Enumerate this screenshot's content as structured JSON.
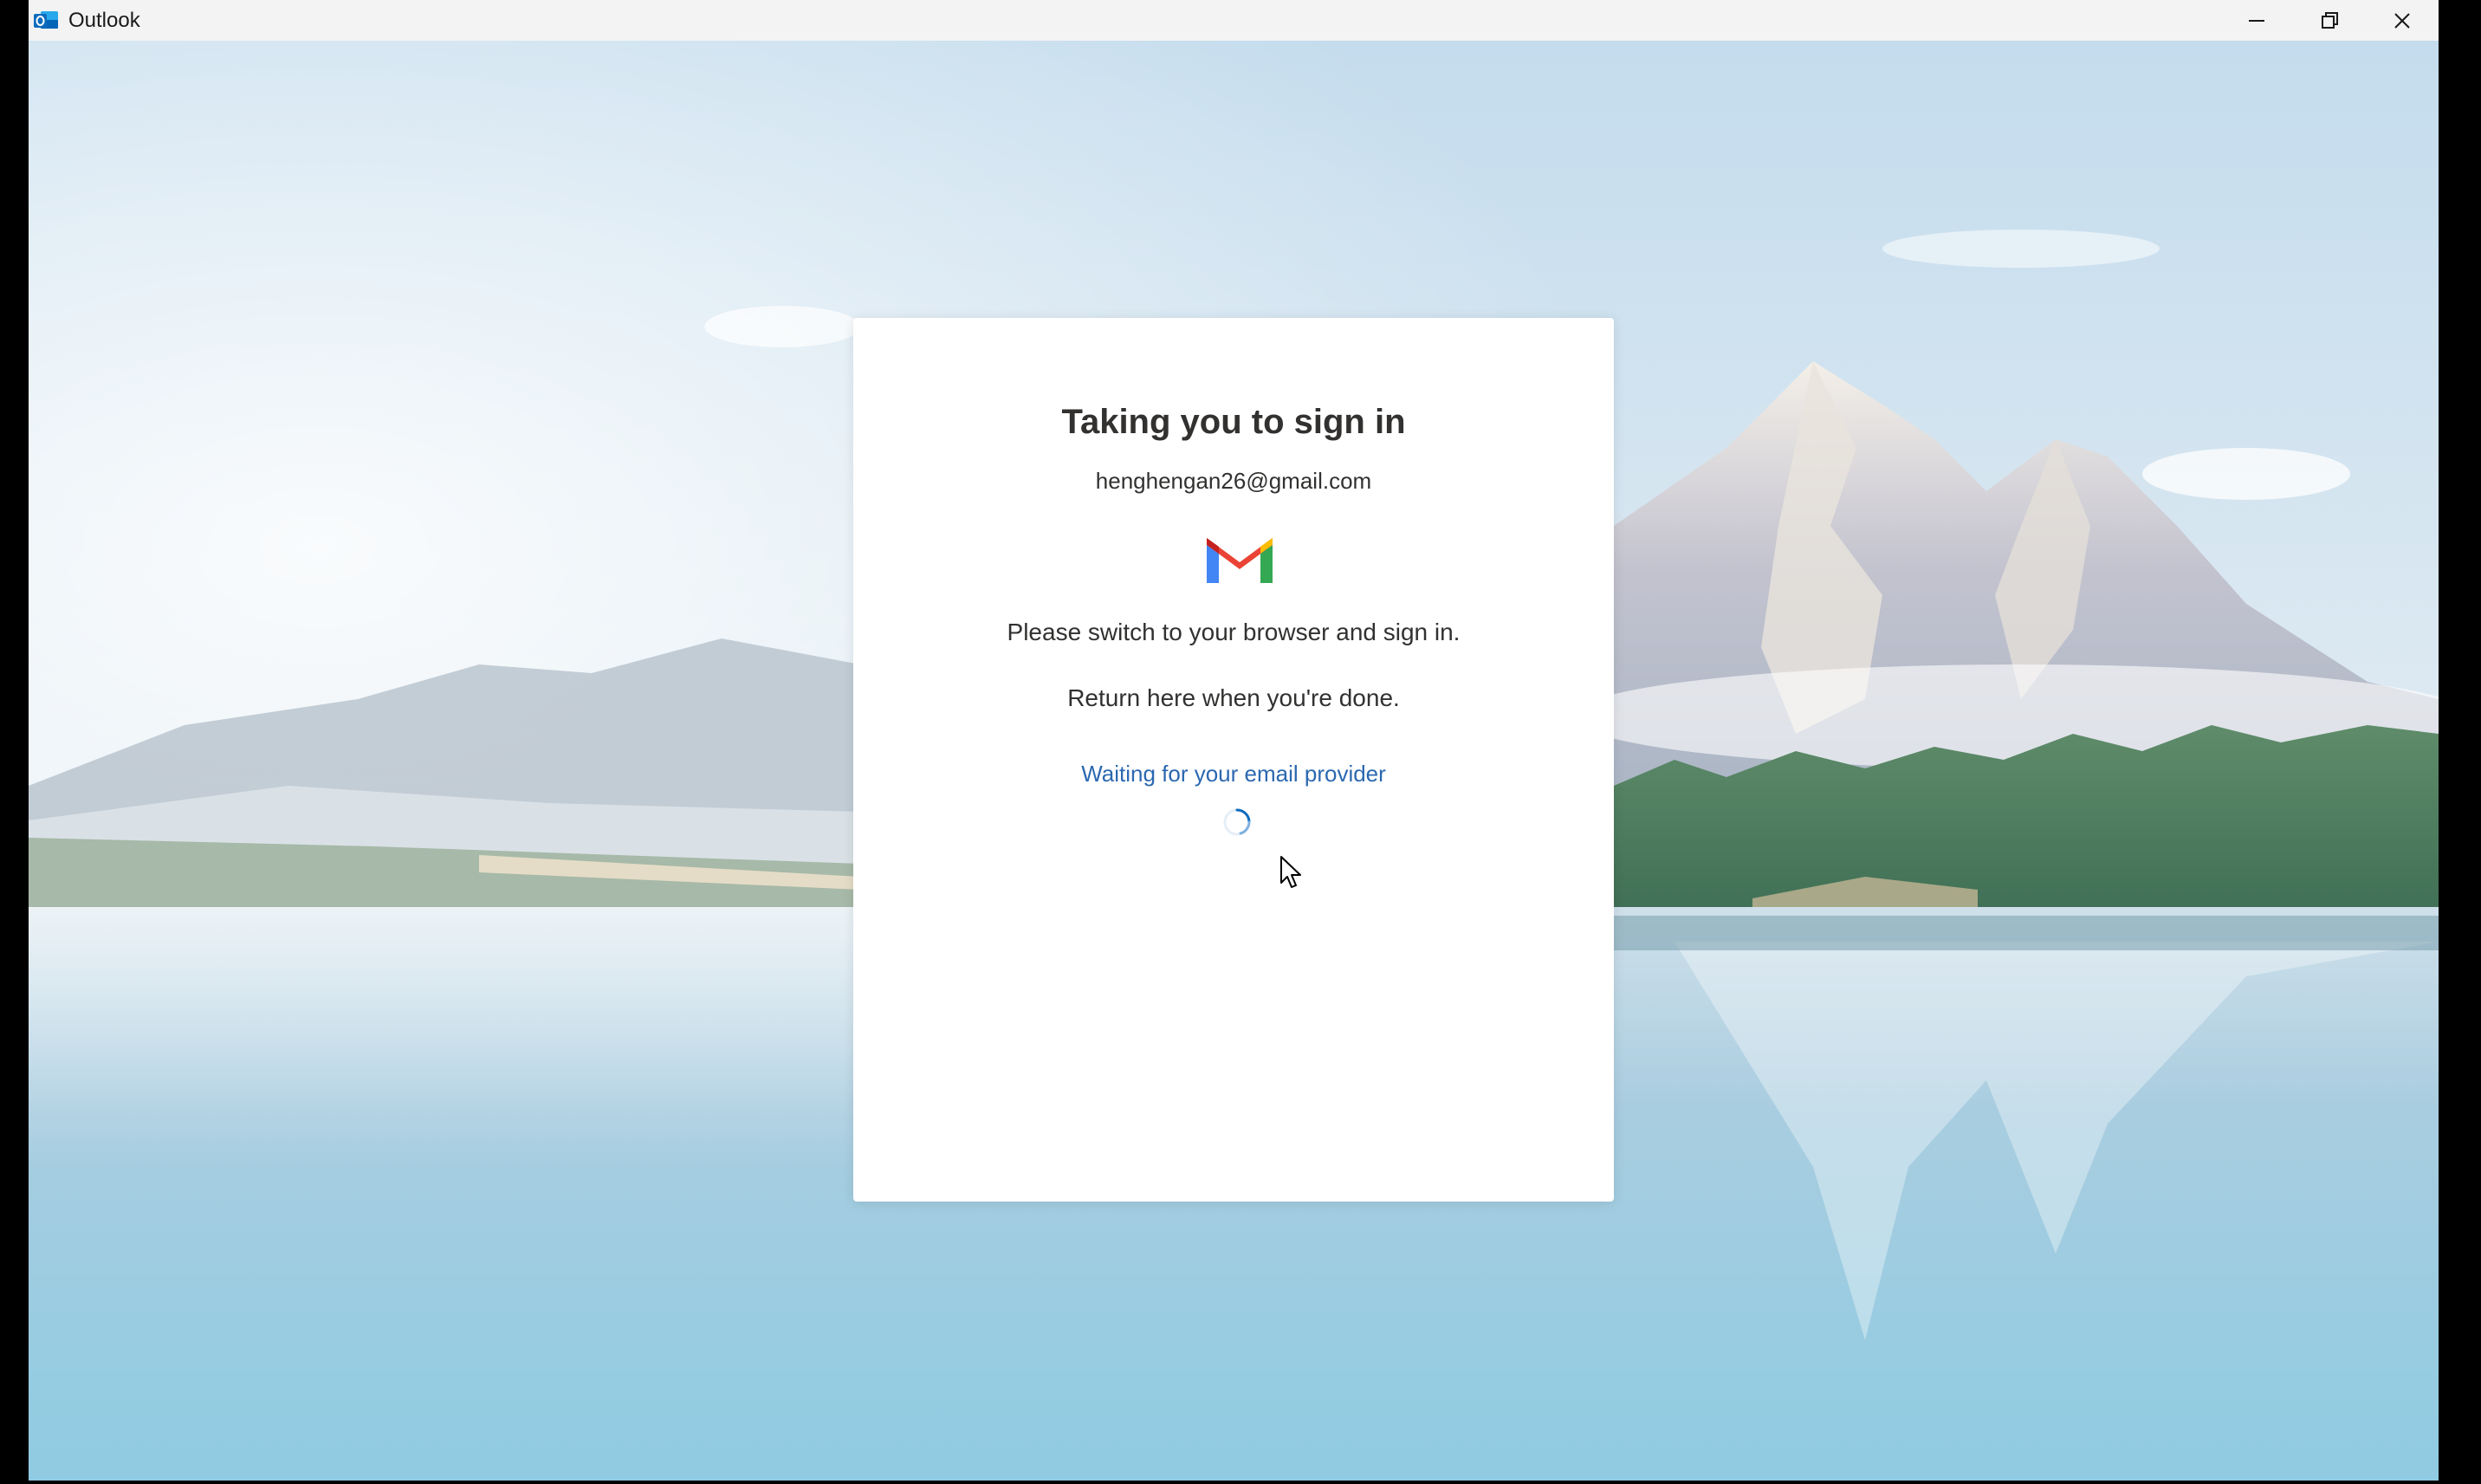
{
  "window": {
    "title": "Outlook",
    "controls": {
      "minimize_icon": "minimize-icon",
      "maximize_icon": "restore-icon",
      "close_icon": "close-icon"
    }
  },
  "dialog": {
    "title": "Taking you to sign in",
    "email": "henghengan26@gmail.com",
    "provider_icon": "gmail-logo",
    "message_line1": "Please switch to your browser and sign in.",
    "message_line2": "Return here when you're done.",
    "status": "Waiting for your email provider",
    "status_color": "#2b68b0"
  },
  "colors": {
    "titlebar": "#f3f3f3",
    "dialog_bg": "#ffffff",
    "text": "#323130",
    "accent": "#0f6cbd"
  }
}
